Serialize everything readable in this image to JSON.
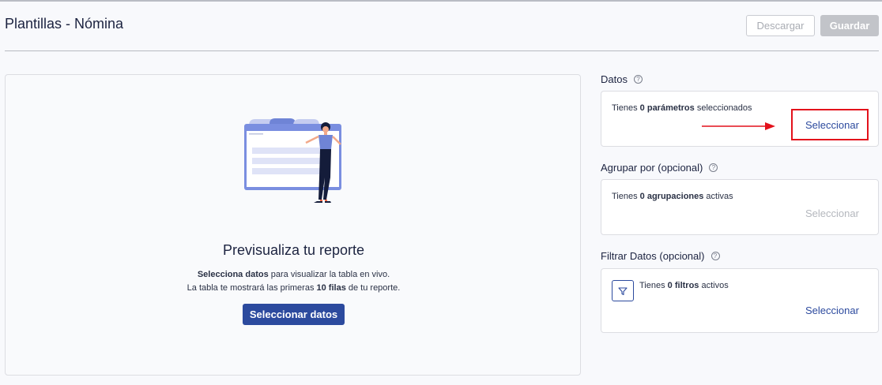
{
  "header": {
    "title": "Plantillas - Nómina",
    "download_label": "Descargar",
    "save_label": "Guardar"
  },
  "preview": {
    "title": "Previsualiza tu reporte",
    "line1_bold": "Selecciona datos",
    "line1_rest": " para visualizar la tabla en vivo.",
    "line2_start": "La tabla te mostrará las primeras ",
    "line2_bold": "10 filas",
    "line2_end": " de tu reporte.",
    "button_label": "Seleccionar datos"
  },
  "datos": {
    "title": "Datos",
    "text_start": "Tienes ",
    "text_bold": "0 parámetros",
    "text_end": " seleccionados",
    "link_label": "Seleccionar"
  },
  "agrupar": {
    "title": "Agrupar por (opcional)",
    "text_start": "Tienes ",
    "text_bold": "0 agrupaciones",
    "text_end": " activas",
    "link_label": "Seleccionar"
  },
  "filtrar": {
    "title": "Filtrar Datos (opcional)",
    "text_start": "Tienes ",
    "text_bold": "0 filtros",
    "text_end": " activos",
    "link_label": "Seleccionar"
  },
  "icons": {
    "help": "help-circle-icon",
    "filter": "filter-icon",
    "arrow": "arrow-right-icon"
  },
  "colors": {
    "accent": "#2c4a9e",
    "highlight": "#e3111b",
    "disabled": "#b4b7bd"
  }
}
